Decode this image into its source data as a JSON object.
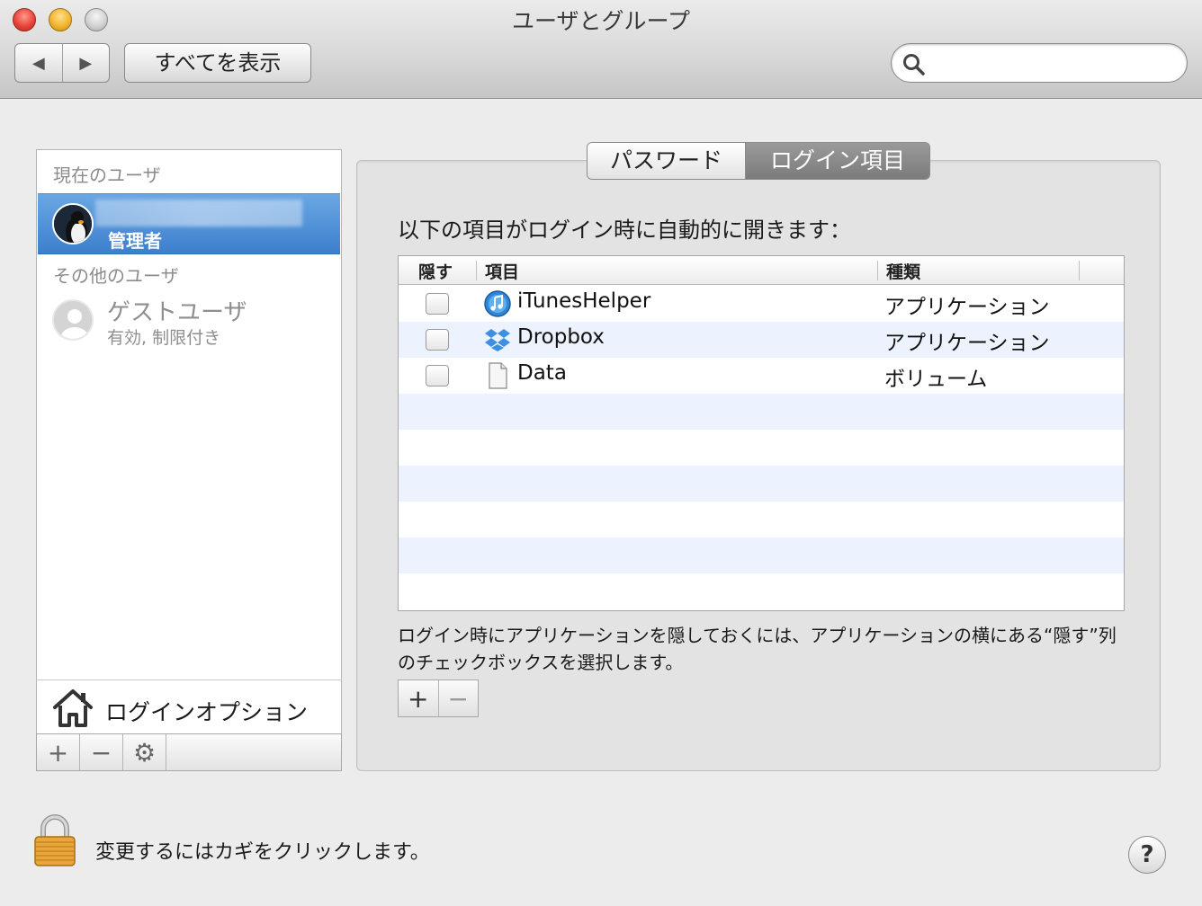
{
  "window": {
    "title": "ユーザとグループ",
    "back_icon": "◀",
    "forward_icon": "▶",
    "show_all_label": "すべてを表示",
    "search": {
      "value": "",
      "placeholder": ""
    }
  },
  "sidebar": {
    "current_users_label": "現在のユーザ",
    "current_user": {
      "role": "管理者"
    },
    "other_users_label": "その他のユーザ",
    "guest_user": {
      "name": "ゲストユーザ",
      "status": "有効, 制限付き"
    },
    "login_options_label": "ログインオプション",
    "buttons": {
      "add": "+",
      "remove": "−",
      "action": "⚙"
    }
  },
  "tabs": [
    {
      "label": "パスワード",
      "active": false
    },
    {
      "label": "ログイン項目",
      "active": true
    }
  ],
  "main": {
    "heading": "以下の項目がログイン時に自動的に開きます：",
    "columns": {
      "hide": "隠す",
      "item": "項目",
      "kind": "種類"
    },
    "rows": [
      {
        "hide": false,
        "name": "iTunesHelper",
        "kind": "アプリケーション",
        "icon": "itunes-icon"
      },
      {
        "hide": false,
        "name": "Dropbox",
        "kind": "アプリケーション",
        "icon": "dropbox-icon"
      },
      {
        "hide": false,
        "name": "Data",
        "kind": "ボリューム",
        "icon": "document-icon"
      }
    ],
    "hint": "ログイン時にアプリケーションを隠しておくには、アプリケーションの横にある“隠す”列のチェックボックスを選択します。",
    "add_label": "+",
    "remove_label": "−"
  },
  "footer": {
    "lock_message": "変更するにはカギをクリックします。",
    "help_label": "?"
  },
  "colors": {
    "selection": "#3c7fcd",
    "active_tab": "#7b7b7b",
    "alt_row": "#edf3fe"
  }
}
